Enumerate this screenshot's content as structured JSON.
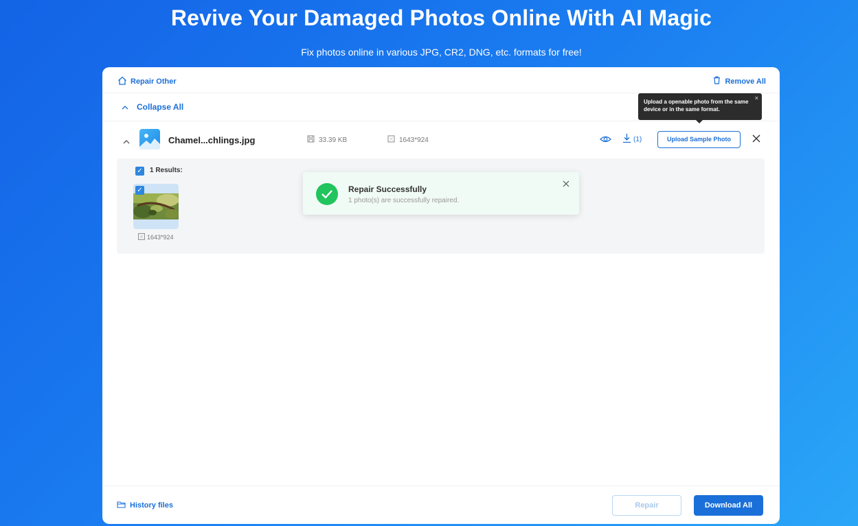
{
  "hero": {
    "title": "Revive Your Damaged Photos Online With AI Magic",
    "subtitle": "Fix photos online in various JPG, CR2, DNG, etc. formats for free!"
  },
  "toolbar": {
    "repair_other": "Repair Other",
    "remove_all": "Remove All",
    "collapse_all": "Collapse All"
  },
  "file": {
    "name": "Chamel...chlings.jpg",
    "size": "33.39 KB",
    "dimensions": "1643*924",
    "download_count": "(1)",
    "upload_sample_label": "Upload Sample Photo"
  },
  "tooltip": {
    "text": "Upload a openable photo from the same device or in the same format.",
    "close": "×"
  },
  "results": {
    "label": "1 Results:",
    "items": [
      {
        "dimensions": "1643*924"
      }
    ]
  },
  "toast": {
    "title": "Repair Successfully",
    "description": "1 photo(s) are successfully repaired."
  },
  "footer": {
    "history": "History files",
    "repair": "Repair",
    "download_all": "Download All"
  },
  "icons": {
    "home": "home-icon",
    "trash": "trash-icon",
    "eye": "eye-icon",
    "download": "download-icon",
    "folder": "folder-icon",
    "check": "check-icon"
  },
  "colors": {
    "accent": "#1a6fd8",
    "success": "#21c45d",
    "tooltip_bg": "#2c2c2c"
  }
}
